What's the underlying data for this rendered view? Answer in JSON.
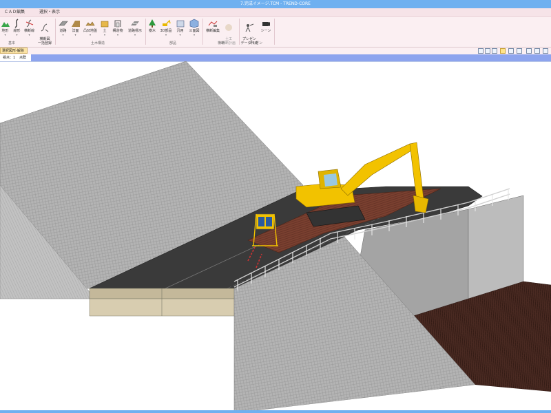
{
  "window": {
    "title": "7.完成イメージ.TCM - TREND-CORE"
  },
  "menu": {
    "items": [
      "ＣＡＤ編集",
      "選択・表示"
    ]
  },
  "ribbon": {
    "groups": [
      {
        "label": "基本",
        "buttons": [
          "地形",
          "線形",
          "横断線",
          "横断図\n一括登録"
        ]
      },
      {
        "label": "土木構造",
        "buttons": [
          "道路",
          "法面",
          "凸凹地盤",
          "土",
          "構造物",
          "道路標示"
        ]
      },
      {
        "label": "部品",
        "buttons": [
          "樹木",
          "3D部品",
          "汎用",
          "三面図"
        ]
      },
      {
        "label": "横断",
        "buttons": [
          "横断編集",
          "土工\n横断計画"
        ]
      },
      {
        "label": "プレゼン",
        "buttons": [
          "プレゼン\nデータ作成",
          "シーン"
        ]
      }
    ]
  },
  "toolstrip": {
    "tab_label": "選択図形-解除"
  },
  "viewbar": {
    "view_label": "視点：1",
    "mode_label": "点群"
  },
  "colors": {
    "titlebar": "#6fb0f0",
    "ribbon_bg": "#fbeff2",
    "road": "#3a3a3a",
    "slope": "#a9a9a9",
    "excavator": "#f2c200",
    "mud": "#4a2a20"
  }
}
